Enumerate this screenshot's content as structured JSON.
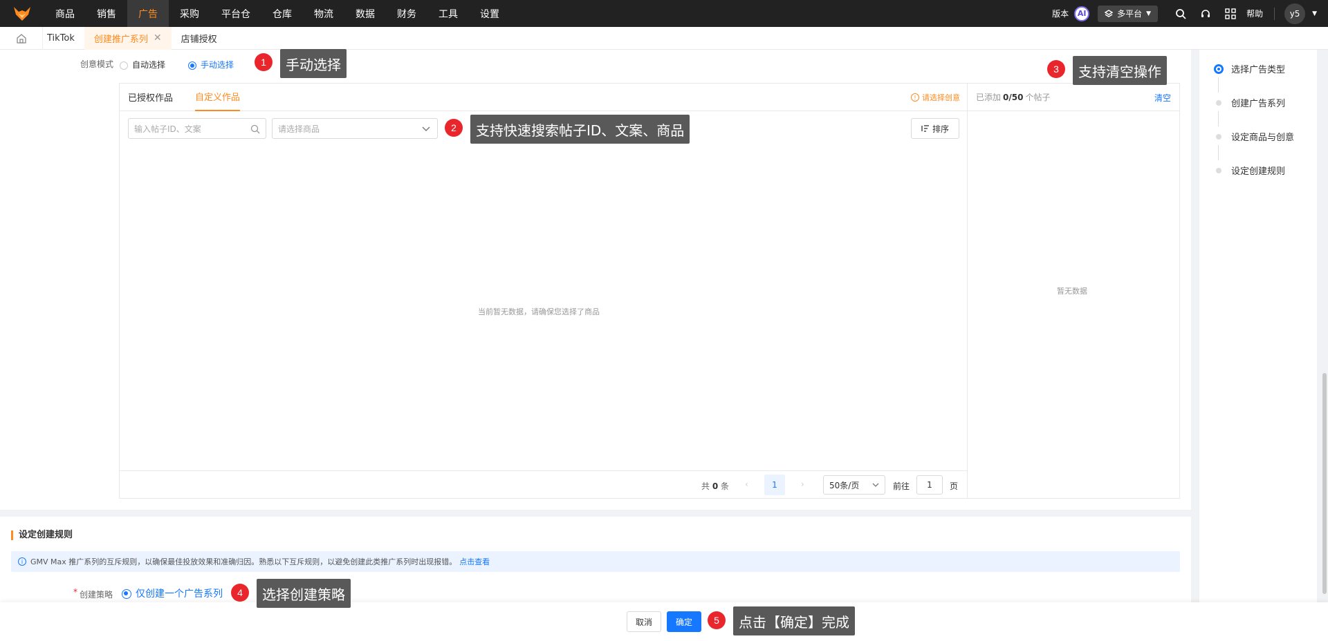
{
  "colors": {
    "accent": "#ff8a1f",
    "primary": "#1677ff",
    "annotation_badge": "#e8262c",
    "annotation_bg": "#595959"
  },
  "topnav": {
    "logo_icon": "fox-logo-icon",
    "items": [
      "商品",
      "销售",
      "广告",
      "采购",
      "平台仓",
      "仓库",
      "物流",
      "数据",
      "财务",
      "工具",
      "设置"
    ],
    "active_index": 2,
    "version_label": "版本",
    "ai_label": "AI",
    "platform_label": "多平台",
    "help_label": "帮助",
    "user_label": "y5"
  },
  "tabs": {
    "items": [
      {
        "label": "TikTok"
      },
      {
        "label": "创建推广系列"
      },
      {
        "label": "店铺授权"
      }
    ],
    "active_index": 1
  },
  "creative_mode": {
    "label": "创意模式",
    "options": [
      "自动选择",
      "手动选择"
    ],
    "selected_index": 1
  },
  "works_panel": {
    "tabs": [
      "已授权作品",
      "自定义作品"
    ],
    "active_tab_index": 1,
    "warning": "请选择创意",
    "search_placeholder": "输入帖子ID、文案",
    "product_placeholder": "请选择商品",
    "sort_label": "排序",
    "empty_text": "当前暂无数据，请确保您选择了商品",
    "pager": {
      "total_prefix": "共",
      "total": "0",
      "total_suffix": "条",
      "current_page": "1",
      "page_size": "50条/页",
      "goto_label": "前往",
      "goto_value": "1",
      "page_suffix": "页"
    }
  },
  "added_panel": {
    "prefix": "已添加",
    "count": "0/50",
    "suffix": "个帖子",
    "clear_label": "清空",
    "empty_text": "暂无数据"
  },
  "rules_section": {
    "title": "设定创建规则",
    "info_text": "GMV Max 推广系列的互斥规则，以确保最佳投放效果和准确归因。熟悉以下互斥规则，以避免创建此类推广系列时出现报错。",
    "info_link": "点击查看",
    "strategy_label": "创建策略",
    "strategy_option": "仅创建一个广告系列"
  },
  "steps": [
    "选择广告类型",
    "创建广告系列",
    "设定商品与创意",
    "设定创建规则"
  ],
  "active_step": 0,
  "footer": {
    "cancel_label": "取消",
    "confirm_label": "确定"
  },
  "annotations": [
    {
      "num": "1",
      "text": "手动选择"
    },
    {
      "num": "2",
      "text": "支持快速搜索帖子ID、文案、商品"
    },
    {
      "num": "3",
      "text": "支持清空操作"
    },
    {
      "num": "4",
      "text": "选择创建策略"
    },
    {
      "num": "5",
      "text": "点击【确定】完成"
    }
  ]
}
